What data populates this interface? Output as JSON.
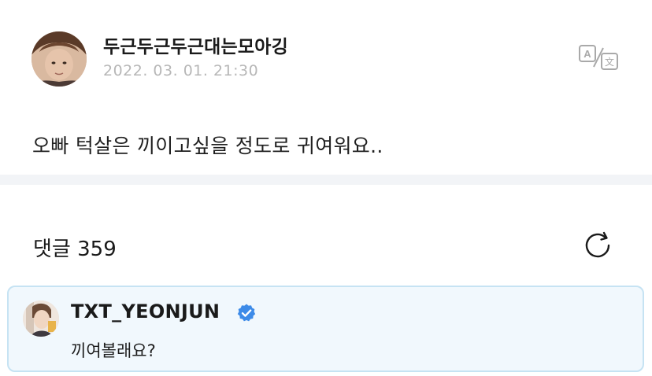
{
  "post": {
    "author": "두근두근두근대는모아깅",
    "timestamp": "2022. 03. 01. 21:30",
    "body": "오빠 턱살은 끼이고싶을 정도로 귀여워요..",
    "translate_icon": "translate-icon"
  },
  "comments": {
    "label": "댓글 359",
    "refresh_icon": "refresh-icon"
  },
  "highlighted_comment": {
    "author": "TXT_YEONJUN",
    "verified_icon": "verified-badge-icon",
    "text": "끼여볼래요?"
  },
  "colors": {
    "divider": "#f2f4f7",
    "comment_bg": "#f1f8fd",
    "comment_border": "#c6e3f3",
    "verified": "#3d8be8",
    "timestamp": "#b7b7b7"
  }
}
